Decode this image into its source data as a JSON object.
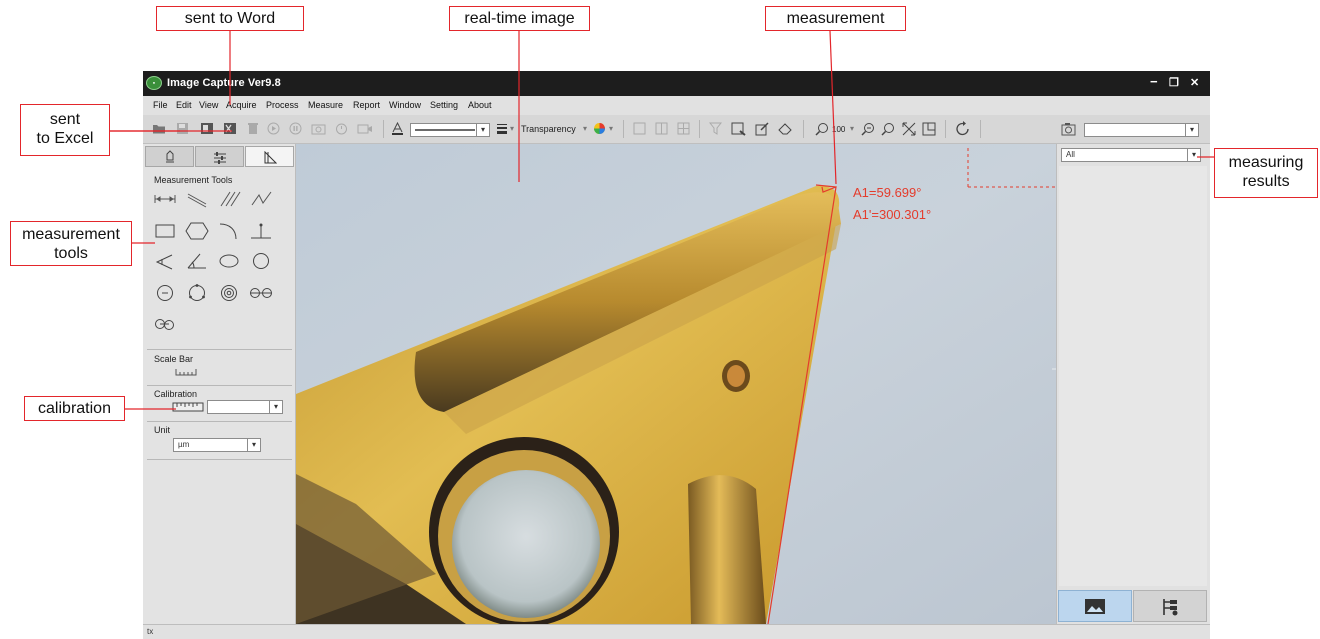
{
  "annotations": {
    "sent_to_word": "sent to Word",
    "real_time_image": "real-time image",
    "measurement": "measurement",
    "sent_to_excel_line1": "sent",
    "sent_to_excel_line2": "to Excel",
    "measurement_tools_line1": "measurement",
    "measurement_tools_line2": "tools",
    "calibration": "calibration",
    "measuring_results_line1": "measuring",
    "measuring_results_line2": "results"
  },
  "window": {
    "title": "Image Capture Ver9.8",
    "minimize": "−",
    "restore": "❐",
    "close": "✕"
  },
  "menu": [
    "File",
    "Edit",
    "View",
    "Acquire",
    "Process",
    "Measure",
    "Report",
    "Window",
    "Setting",
    "About"
  ],
  "toolbar": {
    "transparency_label": "Transparency",
    "zoom_value": "100"
  },
  "left_panel": {
    "measurement_tools_title": "Measurement Tools",
    "scale_bar_title": "Scale Bar",
    "calibration_title": "Calibration",
    "calibration_value": "",
    "unit_title": "Unit",
    "unit_value": "µm"
  },
  "image": {
    "angle_label": "A1=59.699°",
    "angle_supplement_label": "A1'=300.301°"
  },
  "right_panel": {
    "filter_value": "All"
  },
  "statusbar": {
    "text": "tx"
  },
  "colors": {
    "annotation_red": "#e3262b",
    "measure_red": "#e43c2c",
    "titlebar": "#1d1d1d"
  }
}
